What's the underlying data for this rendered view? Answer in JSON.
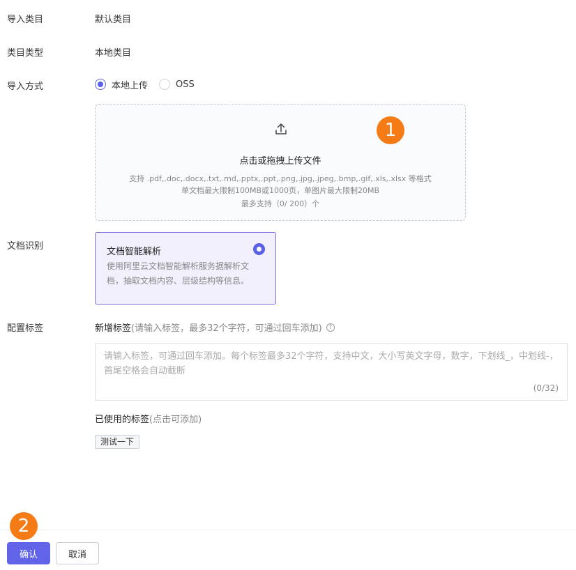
{
  "form": {
    "import_category": {
      "label": "导入类目",
      "value": "默认类目"
    },
    "category_type": {
      "label": "类目类型",
      "value": "本地类目"
    },
    "import_method": {
      "label": "导入方式",
      "options": [
        {
          "label": "本地上传",
          "selected": true
        },
        {
          "label": "OSS",
          "selected": false
        }
      ]
    },
    "upload": {
      "title": "点击或拖拽上传文件",
      "hint_formats": "支持 .pdf,.doc,.docx,.txt,.md,.pptx,.ppt,.png,.jpg,.jpeg,.bmp,.gif,.xls,.xlsx 等格式",
      "hint_limits": "单文档最大限制100MB或1000页，单图片最大限制20MB",
      "hint_max": "最多支持（0/ 200）个",
      "icon": "upload-icon"
    },
    "doc_recognition": {
      "label": "文档识别",
      "option_title": "文档智能解析",
      "option_desc": "使用阿里云文档智能解析服务据解析文档，抽取文档内容、层级结构等信息。",
      "selected": true
    },
    "tags": {
      "label": "配置标签",
      "new_title": "新增标签",
      "new_hint": "(请输入标签，最多32个字符，可通过回车添加)",
      "placeholder": "请输入标签，可通过回车添加。每个标签最多32个字符，支持中文，大小写英文字母，数字，下划线_，中划线-，首尾空格会自动截断",
      "count": "(0/32)",
      "used_title": "已使用的标签",
      "used_hint": "(点击可添加)",
      "used_items": [
        "测试一下"
      ]
    }
  },
  "annotations": {
    "badge_1": "1",
    "badge_2": "2"
  },
  "footer": {
    "confirm_label": "确认",
    "cancel_label": "取消"
  },
  "colors": {
    "primary": "#6164e8",
    "badge": "#f57b16"
  }
}
